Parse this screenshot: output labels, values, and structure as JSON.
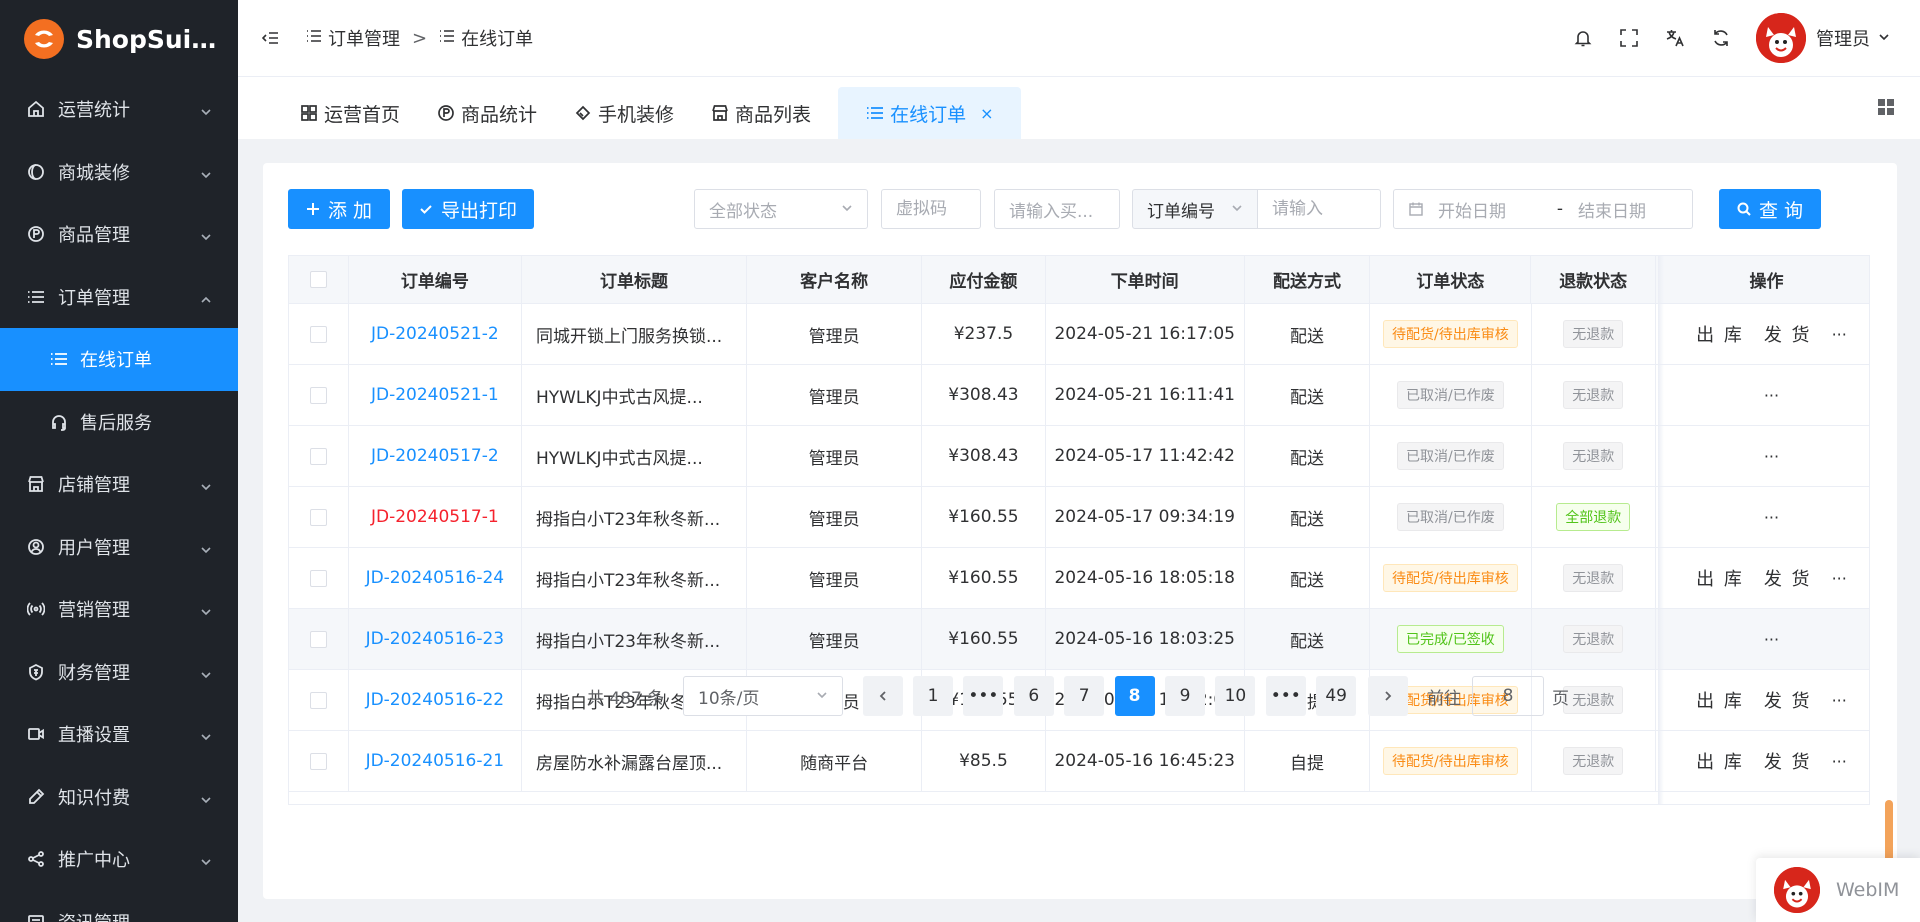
{
  "brand": {
    "name": "ShopSuite..."
  },
  "sidebar": {
    "items": [
      {
        "label": "运营统计",
        "icon": "home-icon"
      },
      {
        "label": "商城装修",
        "icon": "palette-icon"
      },
      {
        "label": "商品管理",
        "icon": "product-icon"
      },
      {
        "label": "订单管理",
        "icon": "list-icon",
        "expanded": true
      },
      {
        "label": "在线订单",
        "icon": "list-icon",
        "sub": true,
        "active": true
      },
      {
        "label": "售后服务",
        "icon": "headset-icon",
        "sub": true
      },
      {
        "label": "店铺管理",
        "icon": "store-icon"
      },
      {
        "label": "用户管理",
        "icon": "user-icon"
      },
      {
        "label": "营销管理",
        "icon": "broadcast-icon"
      },
      {
        "label": "财务管理",
        "icon": "finance-icon"
      },
      {
        "label": "直播设置",
        "icon": "video-icon"
      },
      {
        "label": "知识付费",
        "icon": "pen-icon"
      },
      {
        "label": "推广中心",
        "icon": "share-icon"
      },
      {
        "label": "资讯管理",
        "icon": "news-icon"
      }
    ]
  },
  "header": {
    "breadcrumb": [
      "订单管理",
      "在线订单"
    ],
    "breadcrumb_sep": ">",
    "user_name": "管理员"
  },
  "tabs": [
    {
      "label": "运营首页",
      "icon": "grid-icon"
    },
    {
      "label": "商品统计",
      "icon": "product-icon"
    },
    {
      "label": "手机装修",
      "icon": "brush-icon"
    },
    {
      "label": "商品列表",
      "icon": "store-icon"
    },
    {
      "label": "在线订单",
      "icon": "list-icon",
      "active": true,
      "close": "×"
    }
  ],
  "toolbar": {
    "add_label": "添 加",
    "export_label": "导出打印",
    "status_select": "全部状态",
    "virtual_code_placeholder": "虚拟码",
    "buyer_placeholder": "请输入买...",
    "order_field_select": "订单编号",
    "keyword_placeholder": "请输入",
    "start_date_placeholder": "开始日期",
    "date_sep": "-",
    "end_date_placeholder": "结束日期",
    "query_label": "查 询"
  },
  "table": {
    "columns": [
      "订单编号",
      "订单标题",
      "客户名称",
      "应付金额",
      "下单时间",
      "配送方式",
      "订单状态",
      "退款状态",
      "操作"
    ],
    "rows": [
      {
        "order_no": "JD-20240521-2",
        "title": "同城开锁上门服务换锁...",
        "customer": "管理员",
        "amount": "¥237.5",
        "time": "2024-05-21 16:17:05",
        "delivery": "配送",
        "status": "待配货/待出库审核",
        "status_type": "warn",
        "refund": "无退款",
        "refund_type": "info",
        "actions": [
          "出 库",
          "发 货"
        ],
        "more": "···"
      },
      {
        "order_no": "JD-20240521-1",
        "title": "HYWLKJ中式古风提...",
        "customer": "管理员",
        "amount": "¥308.43",
        "time": "2024-05-21 16:11:41",
        "delivery": "配送",
        "status": "已取消/已作废",
        "status_type": "info",
        "refund": "无退款",
        "refund_type": "info",
        "actions": [],
        "more": "···"
      },
      {
        "order_no": "JD-20240517-2",
        "title": "HYWLKJ中式古风提...",
        "customer": "管理员",
        "amount": "¥308.43",
        "time": "2024-05-17 11:42:42",
        "delivery": "配送",
        "status": "已取消/已作废",
        "status_type": "info",
        "refund": "无退款",
        "refund_type": "info",
        "actions": [],
        "more": "···"
      },
      {
        "order_no": "JD-20240517-1",
        "order_red": true,
        "title": "拇指白小T23年秋冬新...",
        "customer": "管理员",
        "amount": "¥160.55",
        "time": "2024-05-17 09:34:19",
        "delivery": "配送",
        "status": "已取消/已作废",
        "status_type": "info",
        "refund": "全部退款",
        "refund_type": "success",
        "actions": [],
        "more": "···"
      },
      {
        "order_no": "JD-20240516-24",
        "title": "拇指白小T23年秋冬新...",
        "customer": "管理员",
        "amount": "¥160.55",
        "time": "2024-05-16 18:05:18",
        "delivery": "配送",
        "status": "待配货/待出库审核",
        "status_type": "warn",
        "refund": "无退款",
        "refund_type": "info",
        "actions": [
          "出 库",
          "发 货"
        ],
        "more": "···"
      },
      {
        "order_no": "JD-20240516-23",
        "title": "拇指白小T23年秋冬新...",
        "customer": "管理员",
        "amount": "¥160.55",
        "time": "2024-05-16 18:03:25",
        "delivery": "配送",
        "status": "已完成/已签收",
        "status_type": "success",
        "refund": "无退款",
        "refund_type": "info",
        "actions": [],
        "more": "···"
      },
      {
        "order_no": "JD-20240516-22",
        "title": "拇指白小T23年秋冬新...",
        "customer": "管理员",
        "amount": "¥160.55",
        "time": "2024-05-16 18:02:06",
        "delivery": "自提",
        "status": "待配货/待出库审核",
        "status_type": "warn",
        "refund": "无退款",
        "refund_type": "info",
        "actions": [
          "出 库",
          "发 货"
        ],
        "more": "···"
      },
      {
        "order_no": "JD-20240516-21",
        "title": "房屋防水补漏露台屋顶...",
        "customer": "随商平台",
        "amount": "¥85.5",
        "time": "2024-05-16 16:45:23",
        "delivery": "自提",
        "status": "待配货/待出库审核",
        "status_type": "warn",
        "refund": "无退款",
        "refund_type": "info",
        "actions": [
          "出 库",
          "发 货"
        ],
        "more": "···"
      }
    ]
  },
  "pagination": {
    "total": "共 487 条",
    "page_size": "10条/页",
    "pages": [
      "1",
      "•••",
      "6",
      "7",
      "8",
      "9",
      "10",
      "•••",
      "49"
    ],
    "current": "8",
    "goto_label": "前往",
    "goto_value": "8",
    "goto_suffix": "页"
  },
  "webim": {
    "label": "WebIM"
  },
  "colors": {
    "primary": "#1890ff",
    "sidebar_bg": "#1f2329",
    "warn": "#fa8c16",
    "success": "#52c41a",
    "danger": "#f5222d",
    "brand": "#f36f21"
  }
}
